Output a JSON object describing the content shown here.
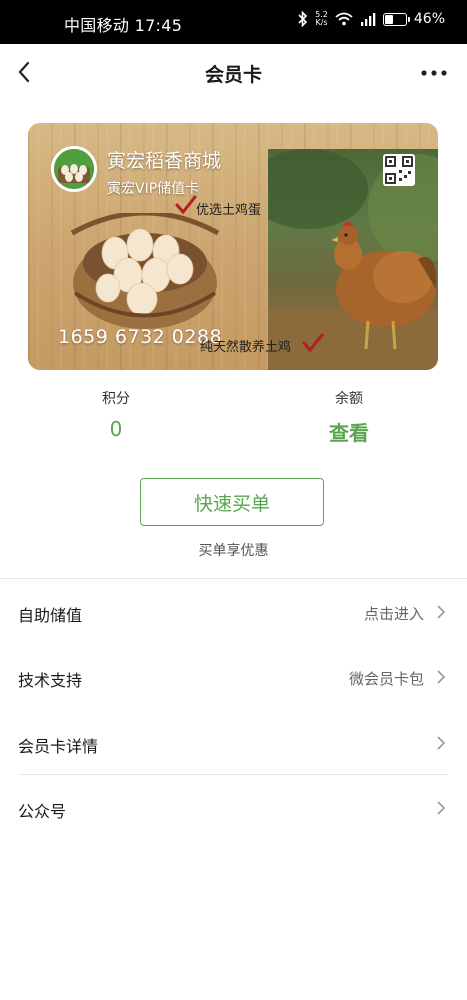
{
  "status_bar": {
    "carrier_time": "中国移动 17:45",
    "net_speed_top": "5.2",
    "net_speed_bottom": "K/s",
    "battery_text": "46%",
    "battery_level": 0.46
  },
  "nav": {
    "title": "会员卡"
  },
  "card": {
    "store_name": "寅宏稻香商城",
    "card_type": "寅宏VIP储值卡",
    "tag_top": "优选土鸡蛋",
    "tag_bottom": "纯天然散养土鸡",
    "card_number": "1659 6732 0288"
  },
  "stats": {
    "points_label": "积分",
    "points_value": "0",
    "balance_label": "余额",
    "balance_value": "查看"
  },
  "quick_buy": {
    "button_label": "快速买单",
    "hint": "买单享优惠"
  },
  "menu": [
    {
      "label": "自助储值",
      "value": "点击进入"
    },
    {
      "label": "技术支持",
      "value": "微会员卡包"
    },
    {
      "label": "会员卡详情",
      "value": ""
    },
    {
      "label": "公众号",
      "value": ""
    }
  ],
  "colors": {
    "accent": "#5aa64f"
  }
}
